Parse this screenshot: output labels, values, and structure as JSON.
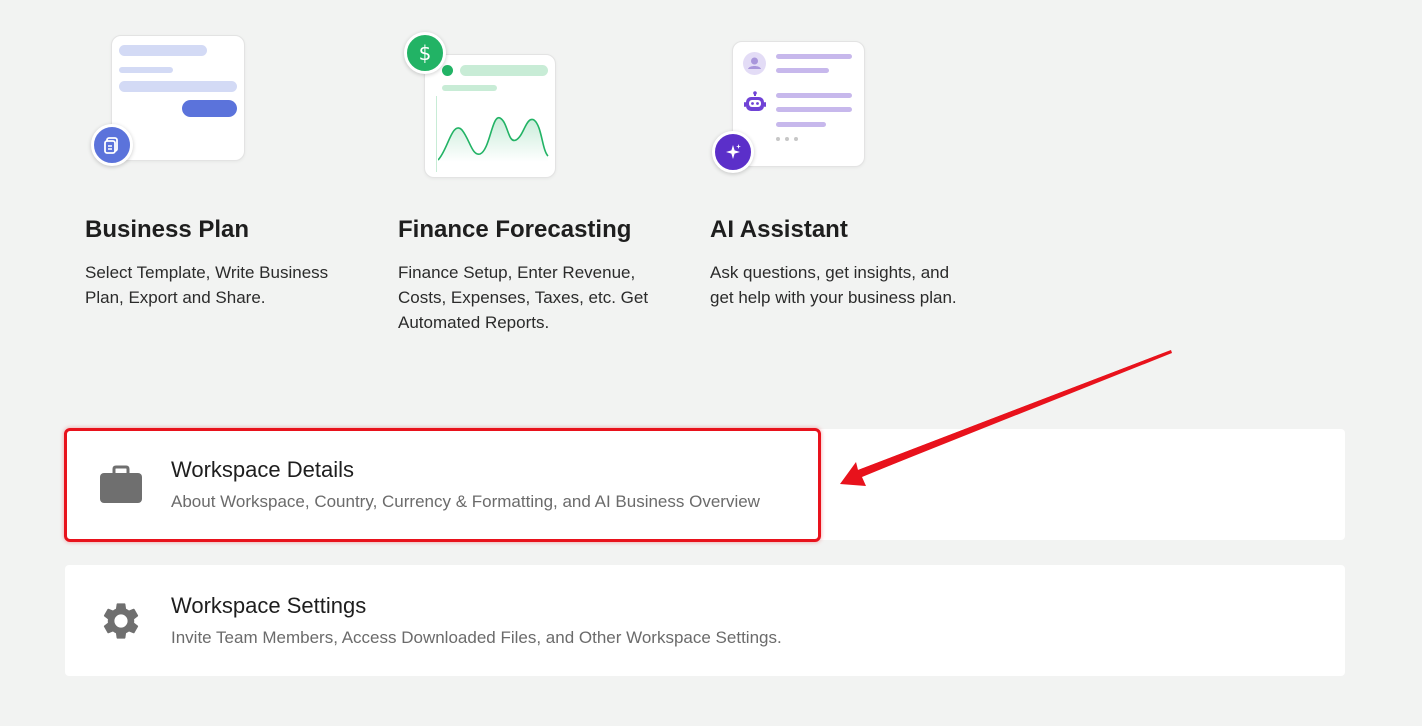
{
  "features": [
    {
      "title": "Business Plan",
      "description": "Select Template, Write Business Plan, Export and Share.",
      "icon": "document-icon",
      "accent": "#5b73db"
    },
    {
      "title": "Finance Forecasting",
      "description": "Finance Setup, Enter Revenue, Costs, Expenses, Taxes, etc. Get Automated Reports.",
      "icon": "dollar-icon",
      "accent": "#22b365"
    },
    {
      "title": "AI Assistant",
      "description": "Ask questions, get insights, and get help with your business plan.",
      "icon": "sparkle-icon",
      "accent": "#5b2fc9"
    }
  ],
  "rows": [
    {
      "title": "Workspace Details",
      "subtitle": "About Workspace, Country, Currency & Formatting, and AI Business Overview",
      "icon": "briefcase-icon",
      "highlighted": true
    },
    {
      "title": "Workspace Settings",
      "subtitle": "Invite Team Members, Access Downloaded Files, and Other Workspace Settings.",
      "icon": "gear-icon",
      "highlighted": false
    }
  ],
  "annotation": {
    "color": "#e8121c",
    "points_to": "Workspace Details"
  }
}
